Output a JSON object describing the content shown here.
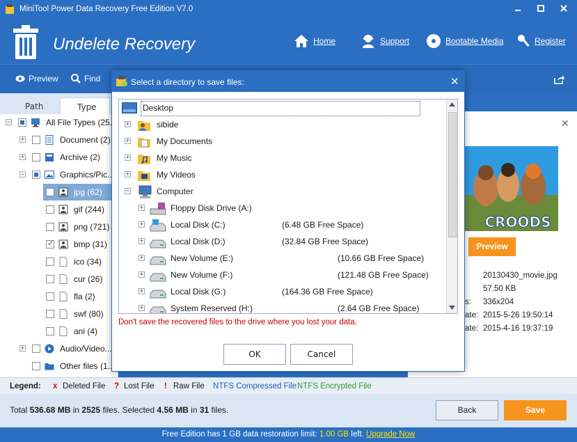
{
  "app": {
    "title": "MiniTool Power Data Recovery Free Edition V7.0",
    "module_title": "Undelete Recovery"
  },
  "nav": {
    "home": "Home",
    "support": "Support",
    "bootable": "Bootable Media",
    "register": "Register"
  },
  "toolbar": {
    "preview": "Preview",
    "find": "Find"
  },
  "left": {
    "tabs": [
      "Path",
      "Type"
    ],
    "tree": [
      {
        "label": "All File Types (25..."
      },
      {
        "label": "Document (2)"
      },
      {
        "label": "Archive (2)"
      },
      {
        "label": "Graphics/Pic..."
      },
      {
        "label": "jpg (62)"
      },
      {
        "label": "gif (244)"
      },
      {
        "label": "png (721)"
      },
      {
        "label": "bmp (31)"
      },
      {
        "label": "ico (34)"
      },
      {
        "label": "cur (26)"
      },
      {
        "label": "fla (2)"
      },
      {
        "label": "swf (80)"
      },
      {
        "label": "ani (4)"
      },
      {
        "label": "Audio/Video..."
      },
      {
        "label": "Other files (1..."
      }
    ]
  },
  "preview_panel": {
    "button": "Preview",
    "poster_text": "CROODS",
    "filename": "20130430_movie.jpg",
    "size": "57.50 KB",
    "dims_label": "s:",
    "dims": "336x204",
    "created_label": "ate:",
    "created": "2015-5-26 19:50:14",
    "modified_label": "ate:",
    "modified": "2015-4-16 19:37:19"
  },
  "legend": {
    "title": "Legend:",
    "deleted_mark": "x",
    "deleted": "Deleted File",
    "lost_mark": "?",
    "lost": "Lost File",
    "raw_mark": "!",
    "raw": "Raw File",
    "ntfs_compressed": "NTFS Compressed File",
    "ntfs_encrypted": "NTFS Encrypted File"
  },
  "status": {
    "total_prefix": "Total ",
    "total_size": "536.68 MB",
    "in": " in ",
    "total_files": "2525",
    "files_sel": " files.  Selected ",
    "sel_size": "4.56 MB",
    "sel_in": " in ",
    "sel_files": "31",
    "files_end": " files.",
    "back": "Back",
    "save": "Save"
  },
  "footer": {
    "pre": "Free Edition has 1 GB data restoration limit: ",
    "limit": "1.00 GB",
    "left": " left. ",
    "upgrade": "Upgrade Now"
  },
  "dialog": {
    "title": "Select a directory to save files:",
    "items": [
      {
        "label": "Desktop",
        "free": ""
      },
      {
        "label": "sibide",
        "free": ""
      },
      {
        "label": "My Documents",
        "free": ""
      },
      {
        "label": "My Music",
        "free": ""
      },
      {
        "label": "My Videos",
        "free": ""
      },
      {
        "label": "Computer",
        "free": ""
      },
      {
        "label": "Floppy Disk Drive (A:)",
        "free": ""
      },
      {
        "label": "Local Disk (C:)",
        "free": "(6.48 GB Free Space)"
      },
      {
        "label": "Local Disk (D:)",
        "free": "(32.84 GB Free Space)"
      },
      {
        "label": "New Volume (E:)",
        "free": "(10.66 GB Free Space)"
      },
      {
        "label": "New Volume (F:)",
        "free": "(121.48 GB Free Space)"
      },
      {
        "label": "Local Disk (G:)",
        "free": "(164.36 GB Free Space)"
      },
      {
        "label": "System Reserved (H:)",
        "free": "(2.64 GB Free Space)"
      }
    ],
    "warning": "Don't save the recovered files to the drive where you lost your data.",
    "ok": "OK",
    "cancel": "Cancel"
  },
  "colors": {
    "brand_blue": "#2b6fc2",
    "accent_orange": "#f7941e",
    "ntfs_compressed": "#1f5fbf",
    "ntfs_encrypted": "#2e9a2e",
    "warning_red": "#c00000"
  }
}
